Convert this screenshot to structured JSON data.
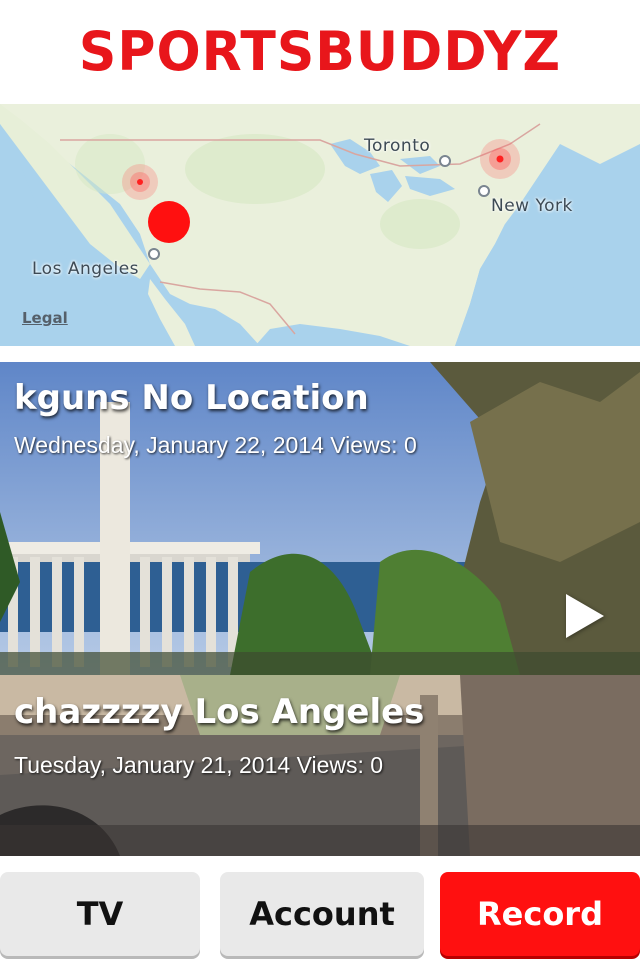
{
  "header": {
    "logo": "SPORTSBUDDYZ"
  },
  "map": {
    "labels": {
      "toronto": "Toronto",
      "new_york": "New York",
      "los_angeles": "Los Angeles"
    },
    "legal": "Legal"
  },
  "videos": [
    {
      "title": "kguns No Location",
      "subtitle": "Wednesday, January 22, 2014 Views: 0"
    },
    {
      "title": "chazzzzy Los Angeles",
      "subtitle": "Tuesday, January 21, 2014 Views: 0"
    }
  ],
  "tabs": {
    "tv": "TV",
    "account": "Account",
    "record": "Record"
  },
  "colors": {
    "brand": "#e8161b",
    "record": "#ff1010",
    "tab_bg": "#e9e9e9"
  }
}
